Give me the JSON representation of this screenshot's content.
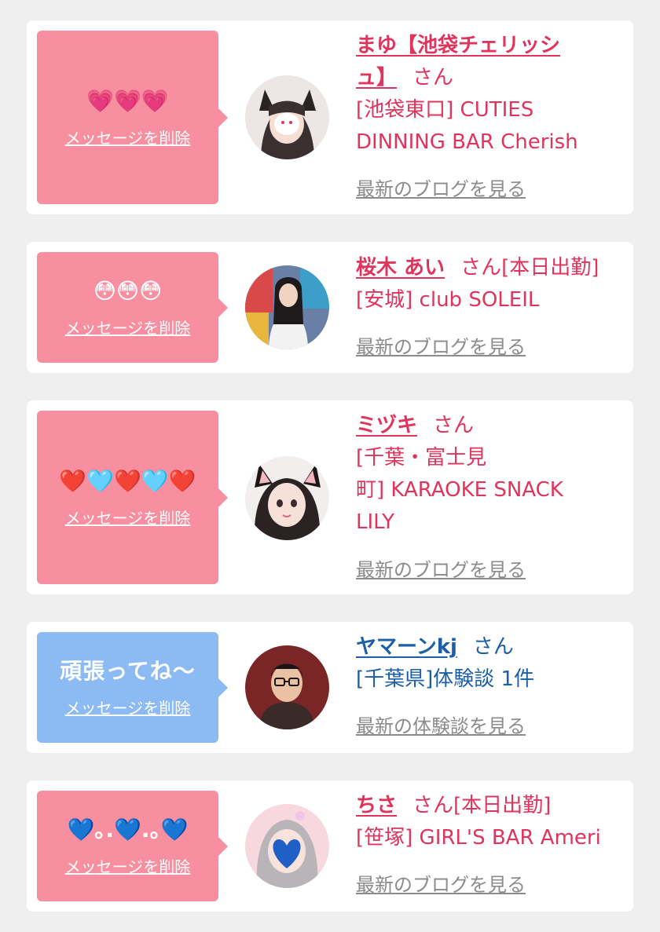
{
  "cards": [
    {
      "message": "💗💗💗",
      "delete_label": "メッセージを削除",
      "name": "まゆ【池袋チェリッシュ】",
      "name_line1": "まゆ【池袋チェリッシ",
      "name_line2": "ュ】",
      "honorific": "さん",
      "status": "",
      "shop_line1": "[池袋東口] CUTIES",
      "shop_line2": "DINNING BAR Cherish",
      "link": "最新のブログを見る"
    },
    {
      "message": "😳😳😳",
      "delete_label": "メッセージを削除",
      "name": "桜木 あい",
      "honorific": "さん",
      "status": "[本日出勤]",
      "shop_line1": "[安城] club SOLEIL",
      "link": "最新のブログを見る"
    },
    {
      "message": "❤️🩵❤️🩵❤️",
      "delete_label": "メッセージを削除",
      "name": "ミヅキ",
      "honorific": "さん",
      "status": "",
      "shop_line1": "[千葉・富士見",
      "shop_line2": "町] KARAOKE SNACK",
      "shop_line3": "LILY",
      "link": "最新のブログを見る"
    },
    {
      "message": "頑張ってね〜",
      "delete_label": "メッセージを削除",
      "name": "ヤマーンkj",
      "honorific": "さん",
      "status": "",
      "shop_line1": "[千葉県]体験談 1件",
      "link": "最新の体験談を見る"
    },
    {
      "message": "💙｡.💙.｡💙",
      "delete_label": "メッセージを削除",
      "name": "ちさ",
      "honorific": "さん",
      "status": "[本日出勤]",
      "shop_line1": "[笹塚] GIRL'S BAR Ameri",
      "link": "最新のブログを見る"
    }
  ],
  "colors": {
    "bubble_pink": "#f78fa0",
    "bubble_blue": "#8cbaf2",
    "name_pink": "#e0345d",
    "name_blue": "#1a5fa8",
    "link_gray": "#8b8b8b",
    "background": "#efefef"
  }
}
